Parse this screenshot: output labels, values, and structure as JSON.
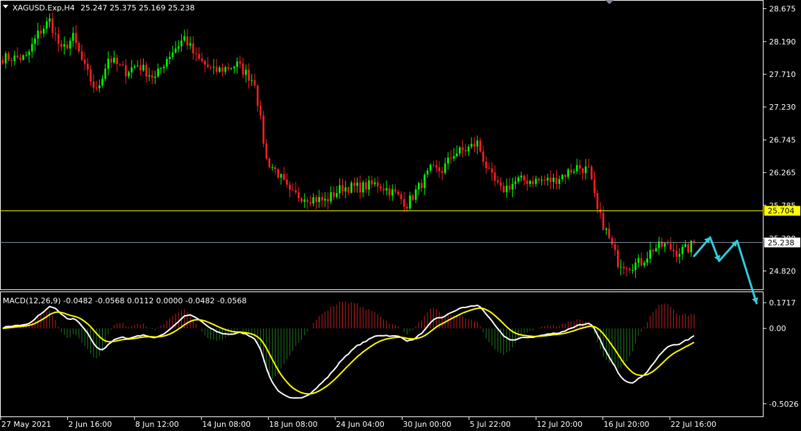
{
  "header": {
    "symbol": "XAGUSD.Exp,H4",
    "ohlc": "25.247 25.375 25.169 25.238"
  },
  "macd_header": "MACD(12,26,9) -0.0482 -0.0568 0.0112 0.0000 -0.0482 -0.0568",
  "colors": {
    "background": "#000000",
    "bull": "#00FF00",
    "bear": "#FF2020",
    "level_line": "#FFFF00",
    "bid_line": "#8899AA",
    "macd_main": "#FFFFFF",
    "macd_signal": "#FFFF00",
    "hist_pos": "#C02020",
    "hist_neg": "#1E7A1E",
    "arrow": "#33CCDD",
    "axis": "#FFFFFF"
  },
  "chart_data": [
    {
      "type": "candlestick",
      "name": "price",
      "y_ticks": [
        "28.675",
        "28.190",
        "27.710",
        "27.230",
        "26.745",
        "26.265",
        "25.785",
        "25.300",
        "24.820"
      ],
      "ylim": [
        24.62,
        28.72
      ],
      "level_value": 25.704,
      "level_label": "25.704",
      "current_value": 25.238,
      "current_label": "25.238",
      "x_tick_labels": [
        "27 May 2021",
        "2 Jun 16:00",
        "8 Jun 12:00",
        "14 Jun 08:00",
        "18 Jun 08:00",
        "24 Jun 04:00",
        "30 Jun 00:00",
        "5 Jul 22:00",
        "12 Jul 20:00",
        "16 Jul 20:00",
        "22 Jul 16:00"
      ],
      "anchors": [
        [
          0,
          27.95
        ],
        [
          8,
          27.95
        ],
        [
          12,
          28.3
        ],
        [
          16,
          28.5
        ],
        [
          20,
          28.05
        ],
        [
          24,
          28.25
        ],
        [
          28,
          27.8
        ],
        [
          32,
          27.45
        ],
        [
          36,
          27.95
        ],
        [
          42,
          27.75
        ],
        [
          46,
          27.85
        ],
        [
          52,
          27.65
        ],
        [
          56,
          27.95
        ],
        [
          62,
          28.25
        ],
        [
          66,
          27.95
        ],
        [
          72,
          27.75
        ],
        [
          80,
          27.85
        ],
        [
          86,
          27.6
        ],
        [
          90,
          26.45
        ],
        [
          94,
          26.25
        ],
        [
          98,
          25.95
        ],
        [
          104,
          25.9
        ],
        [
          110,
          25.85
        ],
        [
          116,
          26.05
        ],
        [
          122,
          26.05
        ],
        [
          128,
          26.1
        ],
        [
          134,
          25.95
        ],
        [
          138,
          25.8
        ],
        [
          142,
          26.05
        ],
        [
          146,
          26.3
        ],
        [
          150,
          26.3
        ],
        [
          154,
          26.55
        ],
        [
          158,
          26.6
        ],
        [
          162,
          26.7
        ],
        [
          166,
          26.25
        ],
        [
          170,
          26.0
        ],
        [
          176,
          26.15
        ],
        [
          182,
          26.15
        ],
        [
          188,
          26.15
        ],
        [
          192,
          26.25
        ],
        [
          196,
          26.35
        ],
        [
          200,
          26.3
        ],
        [
          203,
          25.7
        ],
        [
          206,
          25.4
        ],
        [
          210,
          24.95
        ],
        [
          214,
          24.9
        ],
        [
          218,
          24.95
        ],
        [
          222,
          25.15
        ],
        [
          226,
          25.2
        ],
        [
          230,
          25.1
        ],
        [
          234,
          25.15
        ],
        [
          236,
          25.238
        ]
      ],
      "bar_count": 237
    },
    {
      "type": "macd",
      "name": "MACD(12,26,9)",
      "y_ticks": [
        "0.1717",
        "0.00",
        "-0.5026"
      ],
      "ylim": [
        -0.55,
        0.2
      ]
    }
  ],
  "annotations": {
    "arrow_points": [
      [
        1000,
        369
      ],
      [
        1023,
        342
      ],
      [
        1036,
        376
      ],
      [
        1062,
        347
      ],
      [
        1090,
        437
      ]
    ]
  }
}
